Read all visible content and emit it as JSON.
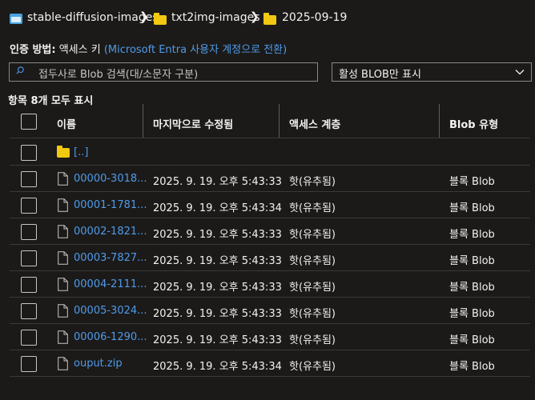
{
  "breadcrumb": {
    "items": [
      "stable-diffusion-images",
      "txt2img-images",
      "2025-09-19"
    ]
  },
  "auth": {
    "label": "인증 방법:",
    "method": "액세스 키",
    "switch_link": "(Microsoft Entra 사용자 계정으로 전환)"
  },
  "search": {
    "placeholder": "접두사로 Blob 검색(대/소문자 구분)"
  },
  "filter": {
    "selected": "활성 BLOB만 표시"
  },
  "list": {
    "count_text": "항목 8개 모두 표시",
    "columns": [
      "이름",
      "마지막으로 수정됨",
      "액세스 계층",
      "Blob 유형"
    ],
    "parent": "[..]",
    "rows": [
      {
        "name": "00000-3018...",
        "modified": "2025. 9. 19. 오후 5:43:33",
        "tier": "핫(유추됨)",
        "type": "블록 Blob"
      },
      {
        "name": "00001-1781...",
        "modified": "2025. 9. 19. 오후 5:43:34",
        "tier": "핫(유추됨)",
        "type": "블록 Blob"
      },
      {
        "name": "00002-1821...",
        "modified": "2025. 9. 19. 오후 5:43:33",
        "tier": "핫(유추됨)",
        "type": "블록 Blob"
      },
      {
        "name": "00003-7827...",
        "modified": "2025. 9. 19. 오후 5:43:33",
        "tier": "핫(유추됨)",
        "type": "블록 Blob"
      },
      {
        "name": "00004-2111...",
        "modified": "2025. 9. 19. 오후 5:43:33",
        "tier": "핫(유추됨)",
        "type": "블록 Blob"
      },
      {
        "name": "00005-3024...",
        "modified": "2025. 9. 19. 오후 5:43:33",
        "tier": "핫(유추됨)",
        "type": "블록 Blob"
      },
      {
        "name": "00006-1290...",
        "modified": "2025. 9. 19. 오후 5:43:33",
        "tier": "핫(유추됨)",
        "type": "블록 Blob"
      },
      {
        "name": "ouput.zip",
        "modified": "2025. 9. 19. 오후 5:43:34",
        "tier": "핫(유추됨)",
        "type": "블록 Blob"
      }
    ]
  },
  "colors": {
    "background": "#1b1a19",
    "link": "#4f9bea",
    "folder": "#f2c811"
  }
}
